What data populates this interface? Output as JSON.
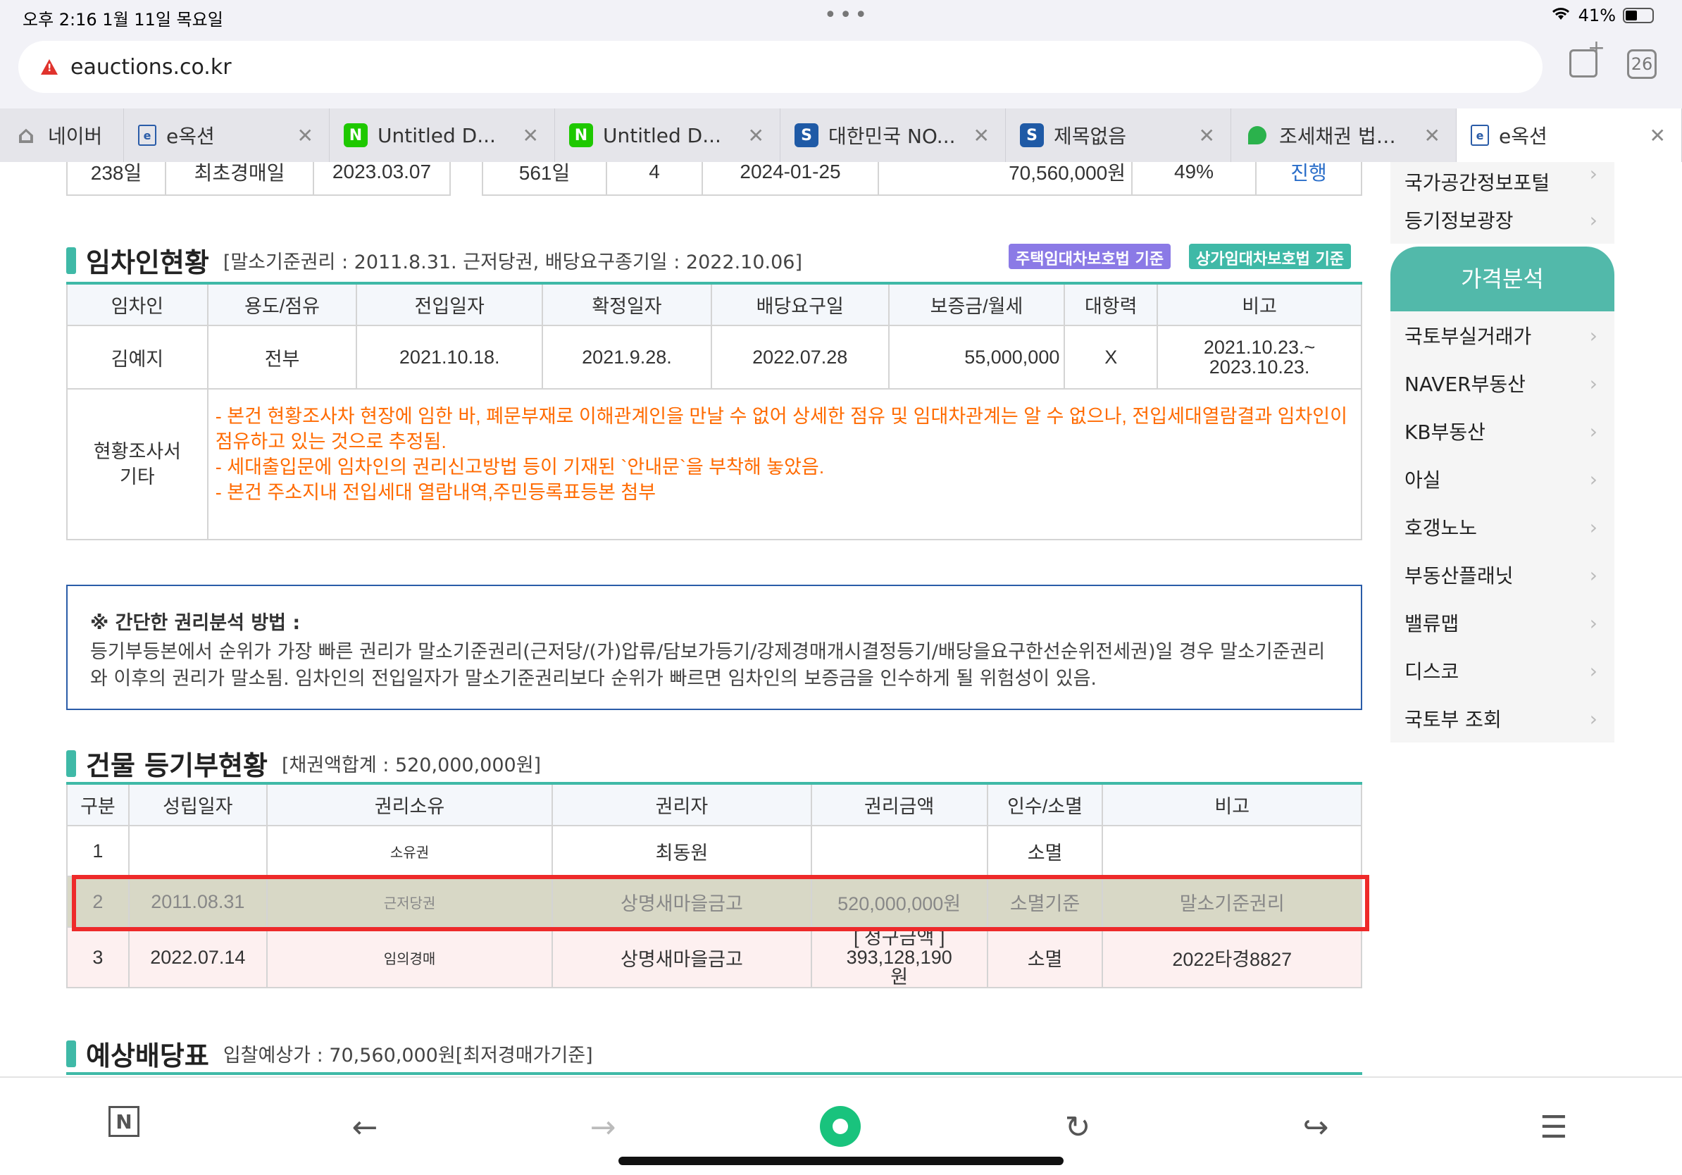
{
  "status": {
    "time_date": "오후 2:16   1월 11일 목요일",
    "dots": "•••",
    "battery": "41%"
  },
  "browser": {
    "url": "eauctions.co.kr",
    "tab_count": "26",
    "tabs": [
      {
        "label": "네이버",
        "icon": "home-icon"
      },
      {
        "label": "e옥션",
        "icon": "eauction-icon"
      },
      {
        "label": "Untitled D...",
        "icon": "naver-n-icon"
      },
      {
        "label": "Untitled D...",
        "icon": "naver-n-icon"
      },
      {
        "label": "대한민국 NO...",
        "icon": "s-app-icon"
      },
      {
        "label": "제목없음",
        "icon": "s-app-icon"
      },
      {
        "label": "조세채권 법…",
        "icon": "green-leaf-icon"
      },
      {
        "label": "e옥션",
        "icon": "eauction-icon"
      }
    ]
  },
  "top_rows": {
    "left": [
      "238일",
      "최초경매일",
      "2023.03.07"
    ],
    "right": [
      "561일",
      "4",
      "2024-01-25",
      "70,560,000원",
      "49%",
      "진행"
    ]
  },
  "tenants": {
    "title": "임차인현황",
    "note": "[말소기준권리 : 2011.8.31. 근저당권, 배당요구종기일 : 2022.10.06]",
    "badge_residential": "주택임대차보호법 기준",
    "badge_commercial": "상가임대차보호법 기준",
    "headers": [
      "임차인",
      "용도/점유",
      "전입일자",
      "확정일자",
      "배당요구일",
      "보증금/월세",
      "대항력",
      "비고"
    ],
    "row": [
      "김예지",
      "전부",
      "2021.10.18.",
      "2021.9.28.",
      "2022.07.28",
      "55,000,000",
      "X",
      "2021.10.23.~ 2023.10.23."
    ],
    "memo_label": "현황조사서 기타",
    "memo_lines": [
      "- 본건 현황조사차 현장에 임한 바, 폐문부재로 이해관계인을 만날 수 없어 상세한 점유 및 임대차관계는 알 수 없으나, 전입세대열람결과 임차인이 점유하고 있는 것으로 추정됨.",
      "- 세대출입문에 임차인의 권리신고방법 등이 기재된 `안내문`을 부착해 놓았음.",
      "- 본건 주소지내 전입세대 열람내역,주민등록표등본 첨부"
    ]
  },
  "info": {
    "head": "※ 간단한 권리분석 방법 :",
    "body": "등기부등본에서 순위가 가장 빠른 권리가 말소기준권리(근저당/(가)압류/담보가등기/강제경매개시결정등기/배당을요구한선순위전세권)일 경우 말소기준권리와 이후의 권리가 말소됨. 임차인의 전입일자가 말소기준권리보다 순위가 빠르면 임차인의 보증금을 인수하게 될 위험성이 있음."
  },
  "registry": {
    "title": "건물 등기부현황",
    "note": "[채권액합계 : 520,000,000원]",
    "headers": [
      "구분",
      "성립일자",
      "권리소유",
      "권리자",
      "권리금액",
      "인수/소멸",
      "비고"
    ],
    "rows": [
      [
        "1",
        "",
        "소유권",
        "최동원",
        "",
        "소멸",
        ""
      ],
      [
        "2",
        "2011.08.31",
        "근저당권",
        "상명새마을금고",
        "520,000,000원",
        "소멸기준",
        "말소기준권리"
      ],
      [
        "3",
        "2022.07.14",
        "임의경매",
        "상명새마을금고",
        "[ 청구금액 ] 393,128,190원",
        "소멸",
        "2022타경8827"
      ]
    ]
  },
  "dividend": {
    "title": "예상배당표",
    "note": "입찰예상가 : 70,560,000원[최저경매가기준]"
  },
  "sidebar": {
    "top_items": [
      "국가공간정보포털",
      "등기정보광장"
    ],
    "header": "가격분석",
    "items": [
      "국토부실거래가",
      "NAVER부동산",
      "KB부동산",
      "아실",
      "호갱노노",
      "부동산플래닛",
      "밸류맵",
      "디스코",
      "국토부 조회"
    ]
  },
  "toolbar": {
    "n_label": "N",
    "back": "←",
    "forward": "→",
    "reload": "↻",
    "share": "↪",
    "menu": "☰"
  },
  "colors": {
    "accent": "#3fb9a7",
    "badge_residential": "#8b7ae6",
    "badge_commercial": "#3fb9a7",
    "memo": "#ff6a00",
    "highlight": "#ee2a2a"
  }
}
